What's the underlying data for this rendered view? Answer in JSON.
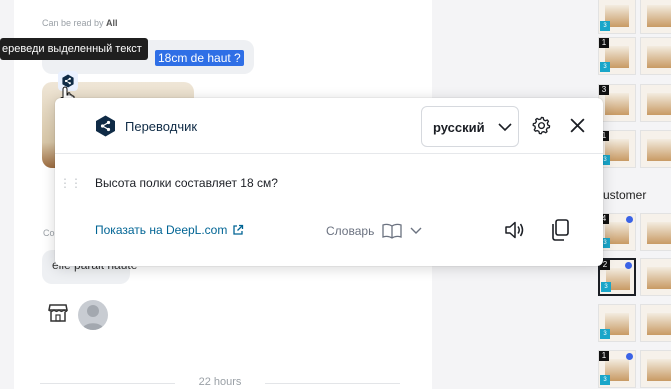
{
  "chat": {
    "read_by_prefix": "Can be read by ",
    "read_by_value": "All",
    "selected_text": "18cm de haut ?",
    "reply_text": "elle parait haute",
    "small_label": "Co",
    "time_separator": "22 hours"
  },
  "tooltip": {
    "text": "ереведи выделенный текст"
  },
  "gallery": {
    "customer_label": "ustomer",
    "thumbs": [
      {
        "num": "",
        "tag": "3",
        "dot": false
      },
      {
        "num": "1",
        "tag": "3",
        "dot": false
      },
      {
        "num": "3",
        "tag": "",
        "dot": false
      },
      {
        "num": "1",
        "tag": "3",
        "dot": false
      },
      {
        "num": "4",
        "tag": "3",
        "dot": true
      },
      {
        "num": "2",
        "tag": "3",
        "dot": true
      },
      {
        "num": "",
        "tag": "3",
        "dot": false
      },
      {
        "num": "1",
        "tag": "3",
        "dot": true
      }
    ]
  },
  "popup": {
    "brand": "Переводчик",
    "target_language": "русский",
    "translation": "Высота полки составляет 18 см?",
    "show_on_deepl": "Показать на DeepL.com",
    "dictionary": "Словарь",
    "accent_color": "#0f2b46",
    "link_color": "#006494"
  }
}
